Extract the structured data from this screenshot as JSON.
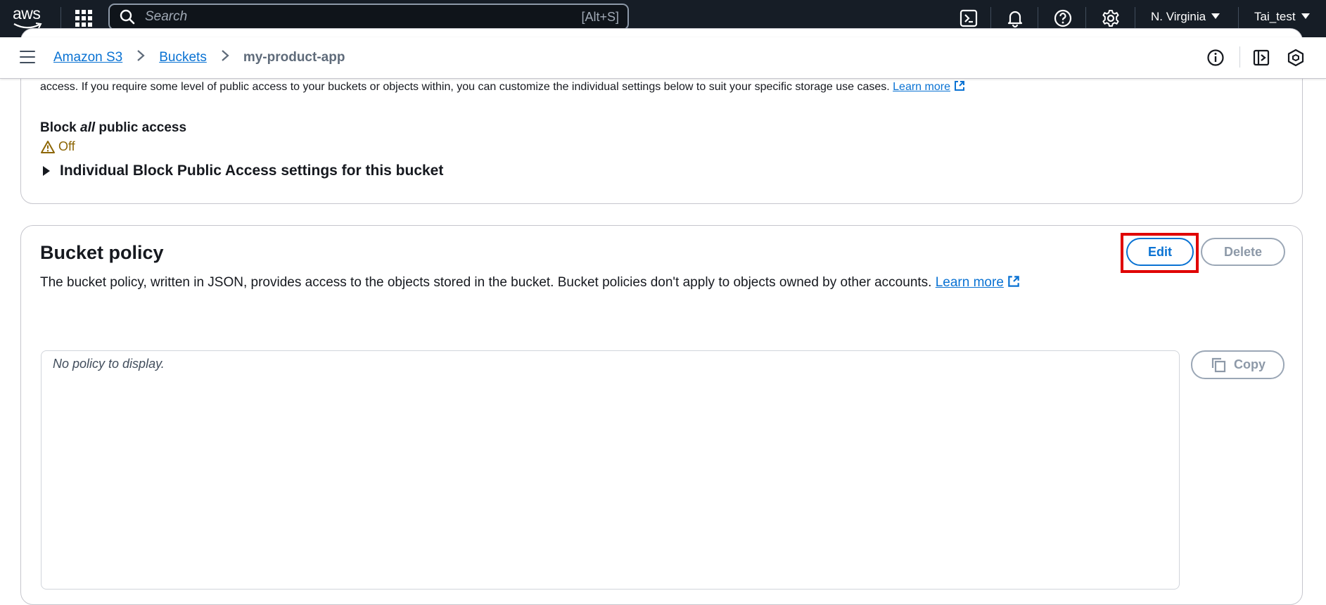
{
  "topnav": {
    "logo_text": "aws",
    "search": {
      "placeholder": "Search",
      "shortcut": "[Alt+S]"
    },
    "icons": [
      "apps-grid-icon",
      "cloudshell-icon",
      "notifications-bell-icon",
      "help-icon",
      "settings-gear-icon"
    ],
    "region": "N. Virginia",
    "user": "Tai_test"
  },
  "breadcrumb": {
    "items": [
      "Amazon S3",
      "Buckets"
    ],
    "current": "my-product-app"
  },
  "public_access": {
    "description": "access. If you require some level of public access to your buckets or objects within, you can customize the individual settings below to suit your specific storage use cases.",
    "learn_more": "Learn more",
    "block_label_pre": "Block ",
    "block_label_em": "all",
    "block_label_post": " public access",
    "status": "Off",
    "expander_label": "Individual Block Public Access settings for this bucket"
  },
  "bucket_policy": {
    "title": "Bucket policy",
    "description": "The bucket policy, written in JSON, provides access to the objects stored in the bucket. Bucket policies don't apply to objects owned by other accounts.",
    "learn_more": "Learn more",
    "edit_label": "Edit",
    "delete_label": "Delete",
    "copy_label": "Copy",
    "empty_text": "No policy to display."
  },
  "colors": {
    "nav_bg": "#161d26",
    "link": "#0972d3",
    "warning": "#8d6605",
    "highlight": "#e00000"
  }
}
